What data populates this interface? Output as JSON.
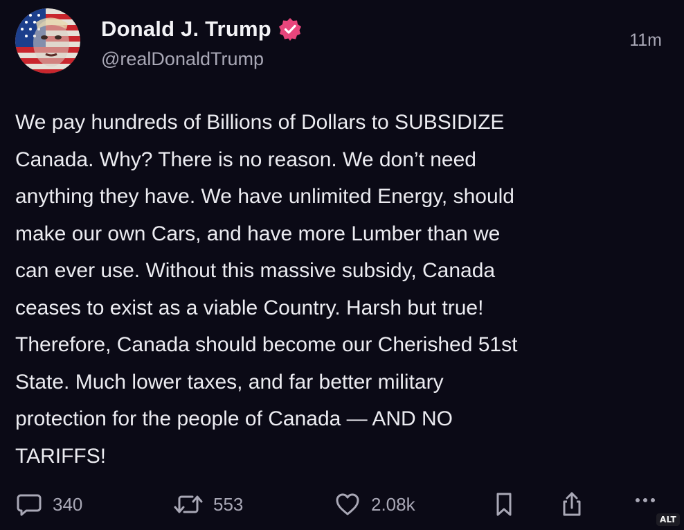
{
  "author": {
    "name": "Donald J. Trump",
    "handle": "@realDonaldTrump",
    "verified": true,
    "avatar_icon": "flag-portrait-avatar"
  },
  "timestamp": "11m",
  "body_lines": [
    "We pay hundreds of Billions of Dollars to SUBSIDIZE",
    "Canada. Why? There is no reason. We don’t need",
    "anything they have. We have unlimited Energy, should",
    "make our own Cars, and have more Lumber than we",
    "can ever use. Without this massive subsidy, Canada",
    "ceases to exist as a viable Country. Harsh but true!",
    "Therefore, Canada should become our Cherished 51st",
    "State. Much lower taxes, and far better military",
    "protection for the people of Canada — AND NO",
    "TARIFFS!"
  ],
  "actions": {
    "reply": {
      "icon": "comment-icon",
      "count": "340"
    },
    "repost": {
      "icon": "repost-icon",
      "count": "553"
    },
    "like": {
      "icon": "heart-icon",
      "count": "2.08k"
    },
    "bookmark": {
      "icon": "bookmark-icon"
    },
    "share": {
      "icon": "share-icon"
    },
    "more": {
      "icon": "more-icon"
    }
  },
  "alt_badge": "ALT",
  "colors": {
    "background": "#0b0a16",
    "text": "#ececf1",
    "muted": "#a9a8b6",
    "verified_badge": "#e8467c"
  }
}
